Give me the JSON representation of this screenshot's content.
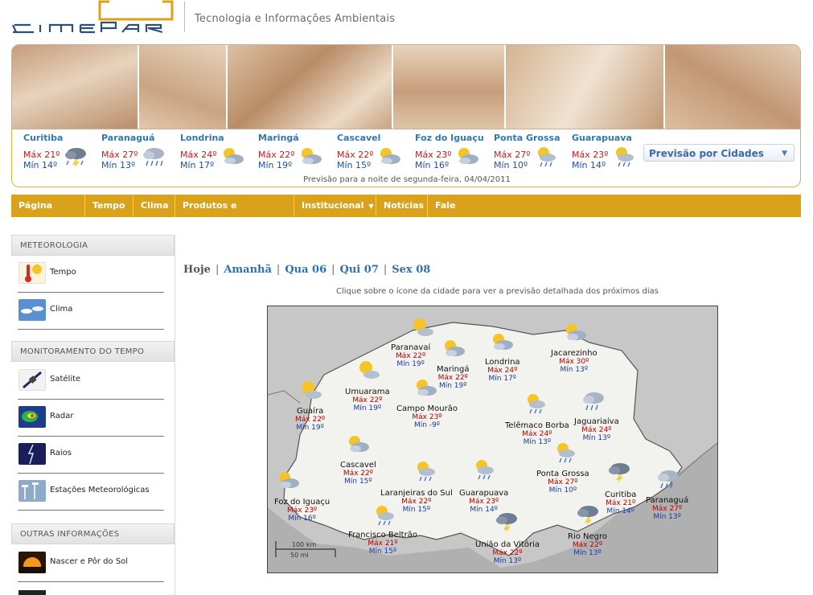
{
  "header": {
    "tagline": "Tecnologia e Informações Ambientais"
  },
  "strip": {
    "cities": [
      {
        "name": "Curitiba",
        "max": "Máx 21º",
        "min": "Mín 14º",
        "icon": "storm-icon"
      },
      {
        "name": "Paranaguá",
        "max": "Máx 27º",
        "min": "Mín 13º",
        "icon": "rain-cloud-icon"
      },
      {
        "name": "Londrina",
        "max": "Máx 24º",
        "min": "Mín 17º",
        "icon": "partly-cloudy-icon"
      },
      {
        "name": "Maringá",
        "max": "Máx 22º",
        "min": "Mín 19º",
        "icon": "partly-cloudy-icon"
      },
      {
        "name": "Cascavel",
        "max": "Máx 22º",
        "min": "Mín 15º",
        "icon": "partly-cloudy-icon"
      },
      {
        "name": "Foz do Iguaçu",
        "max": "Máx 23º",
        "min": "Mín 16º",
        "icon": "partly-cloudy-icon"
      },
      {
        "name": "Ponta Grossa",
        "max": "Máx 27º",
        "min": "Mín 10º",
        "icon": "sun-rain-icon"
      },
      {
        "name": "Guarapuava",
        "max": "Máx 23º",
        "min": "Mín 14º",
        "icon": "sun-rain-icon"
      }
    ],
    "note": "Previsão para a noite de segunda-feira, 04/04/2011",
    "select_label": "Previsão por Cidades"
  },
  "nav": {
    "items": [
      "Página Inicial",
      "Tempo",
      "Clima",
      "Produtos e Serviços",
      "Institucional",
      "Notícias",
      "Fale Conosco"
    ]
  },
  "sidebar": {
    "sections": [
      {
        "title": "METEOROLOGIA",
        "items": [
          "Tempo",
          "Clima"
        ]
      },
      {
        "title": "MONITORAMENTO DO TEMPO",
        "items": [
          "Satélite",
          "Radar",
          "Raios",
          "Estações Meteorológicas"
        ]
      },
      {
        "title": "OUTRAS INFORMAÇÕES",
        "items": [
          "Nascer e Pôr do Sol"
        ]
      }
    ]
  },
  "main": {
    "tabs": [
      "Hoje",
      "Amanhã",
      "Qua 06",
      "Qui 07",
      "Sex 08"
    ],
    "hint": "Clique sobre o ícone da cidade para ver a previsão detalhada dos próximos dias",
    "scale_km": "100 km",
    "scale_mi": "50 mi",
    "map_cities": [
      {
        "name": "Paranavaí",
        "max": "Máx 22º",
        "min": "Mín 19º"
      },
      {
        "name": "Maringá",
        "max": "Máx 22º",
        "min": "Mín 19º"
      },
      {
        "name": "Londrina",
        "max": "Máx 24º",
        "min": "Mín 17º"
      },
      {
        "name": "Jacarezinho",
        "max": "Máx 30º",
        "min": "Mín 13º"
      },
      {
        "name": "Umuarama",
        "max": "Máx 22º",
        "min": "Mín 19º"
      },
      {
        "name": "Campo Mourão",
        "max": "Máx 23º",
        "min": "Mín -9º"
      },
      {
        "name": "Guaíra",
        "max": "Máx 22º",
        "min": "Mín 19º"
      },
      {
        "name": "Telêmaco Borba",
        "max": "Máx 24º",
        "min": "Mín 13º"
      },
      {
        "name": "Jaguariaíva",
        "max": "Máx 24º",
        "min": "Mín 13º"
      },
      {
        "name": "Cascavel",
        "max": "Máx 22º",
        "min": "Mín 15º"
      },
      {
        "name": "Ponta Grossa",
        "max": "Máx 27º",
        "min": "Mín 10º"
      },
      {
        "name": "Curitiba",
        "max": "Máx 21º",
        "min": "Mín 14º"
      },
      {
        "name": "Foz do Iguaçu",
        "max": "Máx 23º",
        "min": "Mín 16º"
      },
      {
        "name": "Laranjeiras do Sul",
        "max": "Máx 22º",
        "min": "Mín 15º"
      },
      {
        "name": "Guarapuava",
        "max": "Máx 23º",
        "min": "Mín 14º"
      },
      {
        "name": "Paranaguá",
        "max": "Máx 27º",
        "min": "Mín 13º"
      },
      {
        "name": "Francisco Beltrão",
        "max": "Máx 21º",
        "min": "Mín 15º"
      },
      {
        "name": "União da Vitória",
        "max": "Máx 22º",
        "min": "Mín 13º"
      },
      {
        "name": "Rio Negro",
        "max": "Máx 22º",
        "min": "Mín 13º"
      }
    ]
  }
}
